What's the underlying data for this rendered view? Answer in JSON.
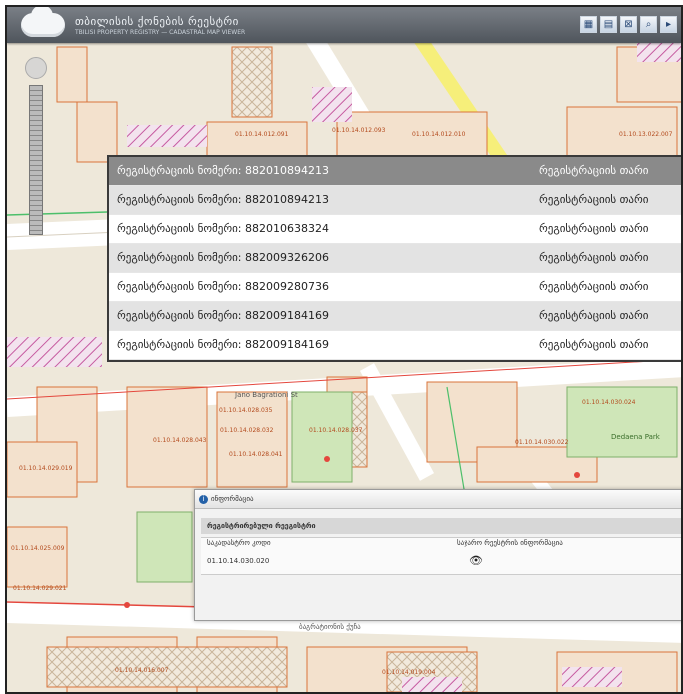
{
  "header": {
    "title": "თბილისის ქონების რეესტრი",
    "subtitle": "TBILISI PROPERTY REGISTRY — CADASTRAL MAP VIEWER"
  },
  "toolbar": {
    "icons": [
      "info-icon",
      "map-icon",
      "layers-icon",
      "extent-icon",
      "search-icon",
      "more-icon"
    ]
  },
  "results": [
    {
      "label": "რეგისტრაციის ნომერი: 882010894213",
      "date_label": "რეგისტრაციის თარი",
      "selected": true
    },
    {
      "label": "რეგისტრაციის ნომერი: 882010894213",
      "date_label": "რეგისტრაციის თარი",
      "selected": false
    },
    {
      "label": "რეგისტრაციის ნომერი: 882010638324",
      "date_label": "რეგისტრაციის თარი",
      "selected": false
    },
    {
      "label": "რეგისტრაციის ნომერი: 882009326206",
      "date_label": "რეგისტრაციის თარი",
      "selected": false
    },
    {
      "label": "რეგისტრაციის ნომერი: 882009280736",
      "date_label": "რეგისტრაციის თარი",
      "selected": false
    },
    {
      "label": "რეგისტრაციის ნომერი: 882009184169",
      "date_label": "რეგისტრაციის თარი",
      "selected": false
    },
    {
      "label": "რეგისტრაციის ნომერი: 882009184169",
      "date_label": "რეგისტრაციის თარი",
      "selected": false
    }
  ],
  "info_panel": {
    "title": "ინფორმაცია",
    "section": "რეგისტრირებული რეეგისტრი",
    "col1_header": "საკადასტრო კოდი",
    "col2_header": "საჯარო რეესტრის ინფორმაცია",
    "code_value": "01.10.14.030.020"
  },
  "map_labels": {
    "parcels": [
      "01.10.14.012.091",
      "01.10.14.012.093",
      "01.10.14.012.010",
      "01.10.13.022.007",
      "01.10.14.028.035",
      "01.10.14.028.043",
      "01.10.14.028.032",
      "01.10.14.028.037",
      "01.10.14.028.041",
      "01.10.14.029.019",
      "01.10.14.030.024",
      "01.10.14.030.022",
      "01.10.14.016.007",
      "01.10.14.019.004",
      "01.10.14.029.021",
      "01.10.14.025.009"
    ],
    "streets": [
      "Jano Bagrationi St",
      "ბაგრატიონის ქუჩა"
    ],
    "park": "Dedaena Park"
  },
  "colors": {
    "parcel_stroke": "#d9743a",
    "road": "#ffffff",
    "highlight_road": "#f6ef7a",
    "park": "#cfe6b8",
    "hatch": "#c65aa0",
    "selected_row": "#8a8a8a"
  }
}
